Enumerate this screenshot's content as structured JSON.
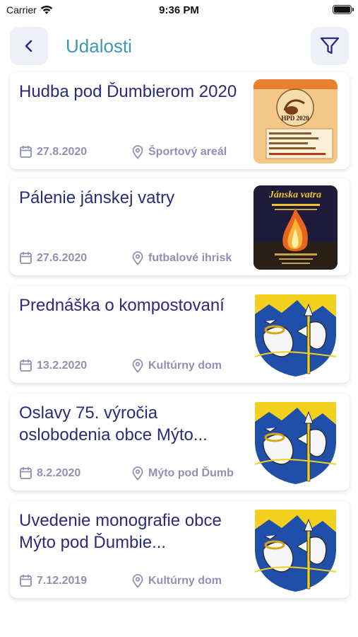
{
  "status_bar": {
    "carrier": "Carrier",
    "time": "9:36 PM"
  },
  "header": {
    "title": "Udalosti",
    "back_icon": "chevron-left-icon",
    "filter_icon": "filter-icon"
  },
  "events": [
    {
      "title": "Hudba pod Ďumbierom 2020",
      "date": "27.8.2020",
      "place": "Športový areál",
      "image": "poster-hpd-2020",
      "poster_text": "HPD 2020"
    },
    {
      "title": "Pálenie jánskej vatry",
      "date": "27.6.2020",
      "place": "futbalové ihrisk",
      "image": "poster-janska-vatra",
      "poster_text": "Jánska vatra"
    },
    {
      "title": "Prednáška o kompostovaní",
      "date": "13.2.2020",
      "place": "Kultúrny dom",
      "image": "coat-of-arms"
    },
    {
      "title": "Oslavy 75. výročia oslobodenia obce Mýto...",
      "date": "8.2.2020",
      "place": "Mýto pod Ďumb",
      "image": "coat-of-arms"
    },
    {
      "title": "Uvedenie monografie obce Mýto pod Ďumbie...",
      "date": "7.12.2019",
      "place": "Kultúrny dom",
      "image": "coat-of-arms"
    }
  ],
  "colors": {
    "title": "#3a97b8",
    "event_title": "#2a2b7a",
    "meta": "#8f90b4",
    "button_bg": "#eef0f8"
  }
}
